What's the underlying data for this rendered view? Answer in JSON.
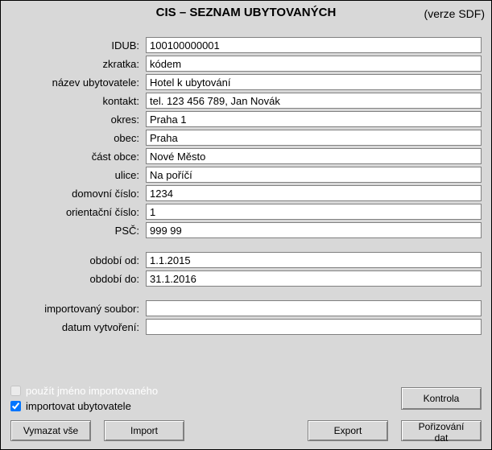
{
  "header": {
    "title": "CIS – SEZNAM UBYTOVANÝCH",
    "version": "(verze SDF)"
  },
  "fields": {
    "idub": {
      "label": "IDUB:",
      "value": "100100000001"
    },
    "zkratka": {
      "label": "zkratka:",
      "value": "kódem"
    },
    "nazev_ubytovatele": {
      "label": "název ubytovatele:",
      "value": "Hotel k ubytování"
    },
    "kontakt": {
      "label": "kontakt:",
      "value": "tel. 123 456 789, Jan Novák"
    },
    "okres": {
      "label": "okres:",
      "value": "Praha 1"
    },
    "obec": {
      "label": "obec:",
      "value": "Praha"
    },
    "cast_obce": {
      "label": "část obce:",
      "value": "Nové Město"
    },
    "ulice": {
      "label": "ulice:",
      "value": "Na poříčí"
    },
    "domovni_cislo": {
      "label": "domovní číslo:",
      "value": "1234"
    },
    "orientacni_cislo": {
      "label": "orientační číslo:",
      "value": "1"
    },
    "psc": {
      "label": "PSČ:",
      "value": "999 99"
    },
    "obdobi_od": {
      "label": "období od:",
      "value": "1.1.2015"
    },
    "obdobi_do": {
      "label": "období do:",
      "value": "31.1.2016"
    },
    "importovany_soubor": {
      "label": "importovaný soubor:",
      "value": ""
    },
    "datum_vytvoreni": {
      "label": "datum vytvoření:",
      "value": ""
    }
  },
  "checkboxes": {
    "pouzit_jmeno": {
      "label": "použít jméno importovaného",
      "checked": false,
      "disabled": true
    },
    "importovat_ubytovatele": {
      "label": "importovat ubytovatele",
      "checked": true,
      "disabled": false
    }
  },
  "buttons": {
    "kontrola": "Kontrola",
    "vymazat_vse": "Vymazat vše",
    "import": "Import",
    "export": "Export",
    "porizovani_dat": "Pořizování dat"
  }
}
